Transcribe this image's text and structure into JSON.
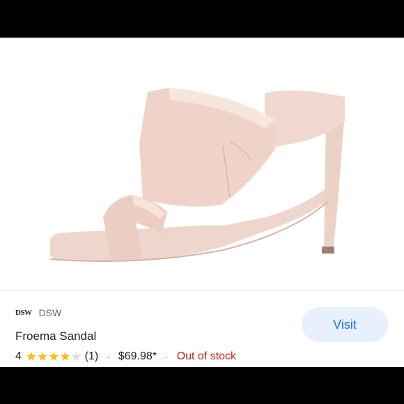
{
  "merchant": {
    "logo_text": "DSW",
    "name": "DSW"
  },
  "product": {
    "title": "Froema Sandal",
    "image_icon": "pink-high-heel-mule-sandal"
  },
  "rating": {
    "value": "4",
    "stars": 4,
    "max_stars": 5,
    "count": "(1)"
  },
  "separator": "·",
  "price": "$69.98*",
  "stock_status": "Out of stock",
  "visit_label": "Visit",
  "colors": {
    "accent": "#1a73e8",
    "star": "#fbbc04",
    "out_of_stock": "#c5221f",
    "button_bg": "#e8f0fe"
  }
}
